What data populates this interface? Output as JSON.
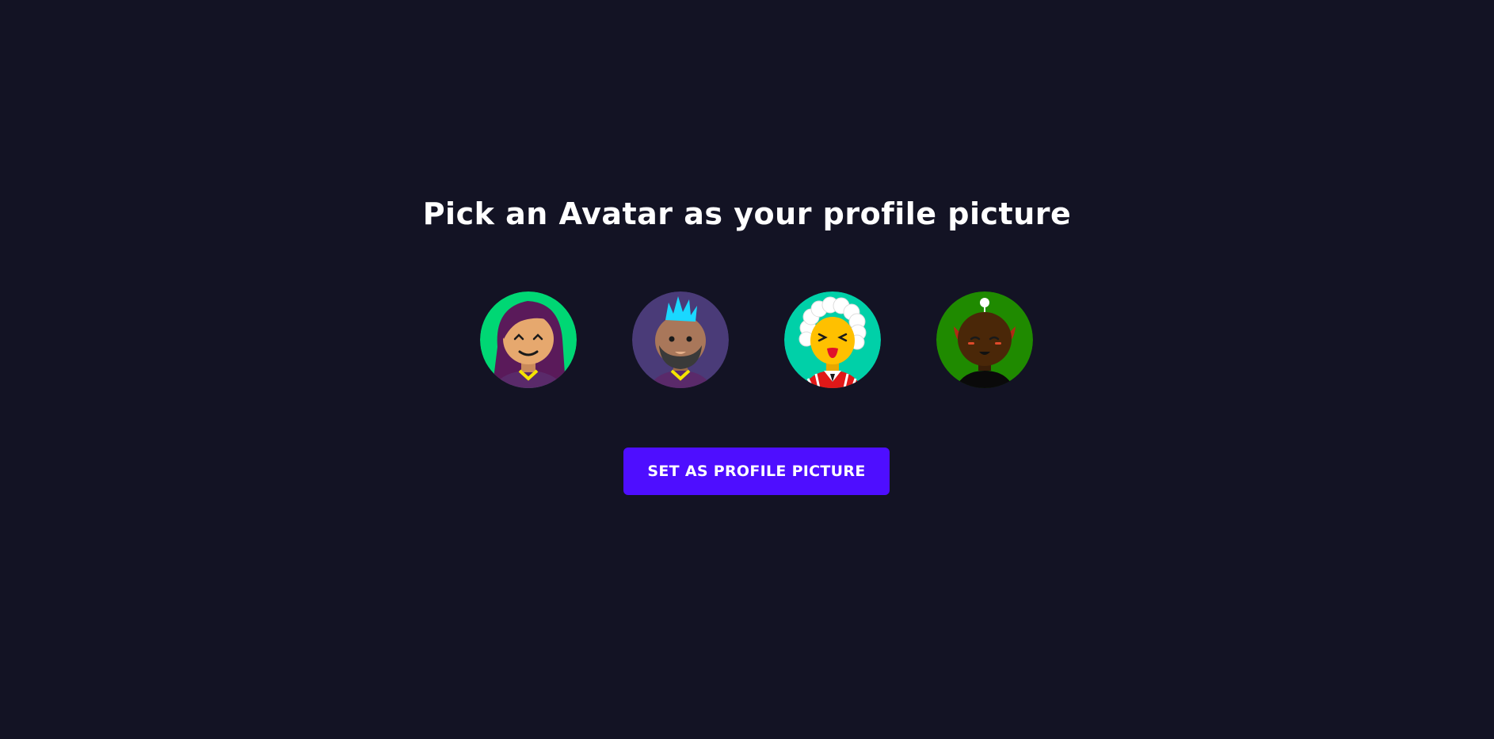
{
  "page": {
    "title": "Pick an Avatar as your profile picture",
    "background": "#131324"
  },
  "avatars": [
    {
      "name": "avatar-woman-purple-hair",
      "bg": "#00d774"
    },
    {
      "name": "avatar-man-blue-mohawk",
      "bg": "#4a3b78"
    },
    {
      "name": "avatar-white-curly-hair",
      "bg": "#00d0a8"
    },
    {
      "name": "avatar-alien-green",
      "bg": "#1f8a00"
    }
  ],
  "button": {
    "label": "Set as Profile Picture",
    "color": "#4e0eff"
  }
}
